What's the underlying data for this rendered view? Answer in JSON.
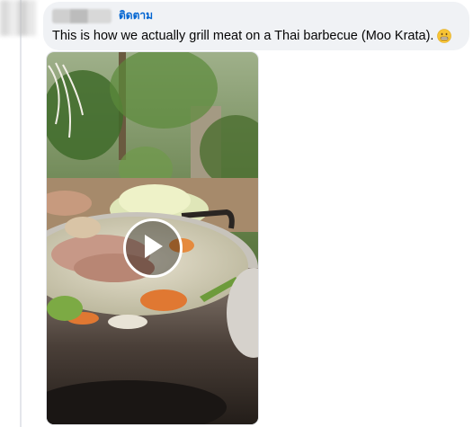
{
  "comment": {
    "follow_label": "ติดตาม",
    "text": "This is how we actually grill meat on a Thai barbecue (Moo Krata).",
    "emoji": "grimacing-face-emoji"
  },
  "video": {
    "thumbnail": "moo-krata-grill-pot-with-meat-and-vegetables",
    "play_icon": "play-icon"
  },
  "colors": {
    "bubble_bg": "#f0f2f5",
    "link_blue": "#0064d1",
    "text": "#050505",
    "thread_line": "#e4e6eb"
  }
}
